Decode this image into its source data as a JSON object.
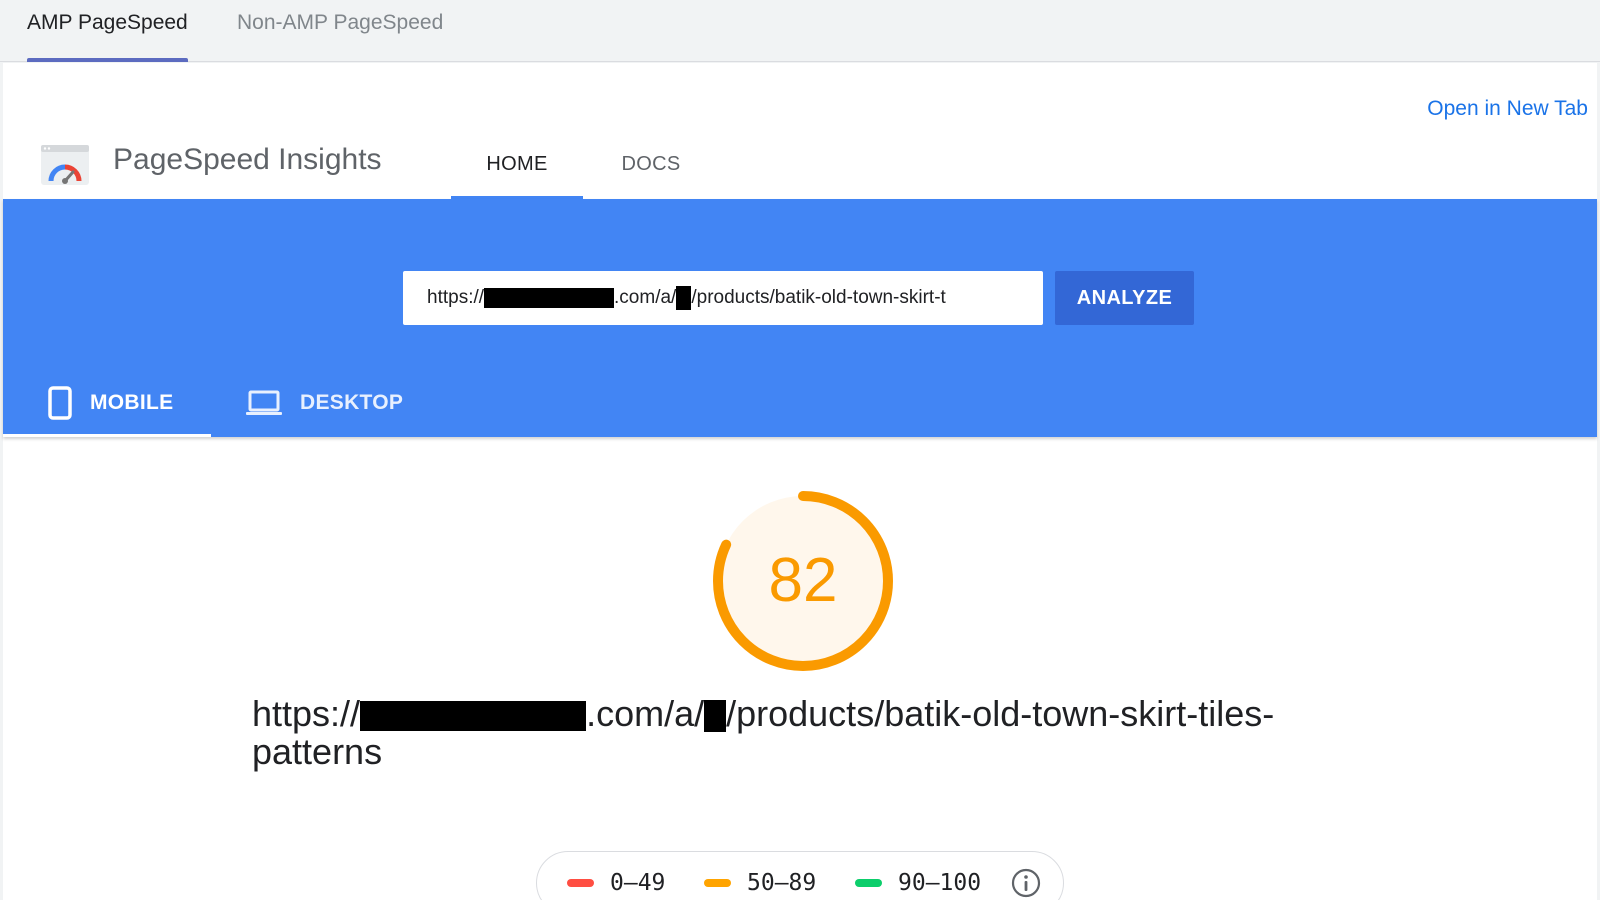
{
  "outer_tabs": [
    {
      "label": "AMP PageSpeed",
      "active": true
    },
    {
      "label": "Non-AMP PageSpeed",
      "active": false
    }
  ],
  "open_new_tab": "Open in New Tab",
  "app": {
    "title": "PageSpeed Insights",
    "nav": [
      {
        "label": "HOME",
        "active": true
      },
      {
        "label": "DOCS",
        "active": false
      }
    ]
  },
  "search": {
    "url_prefix": "https://",
    "url_middle": ".com/a/",
    "url_suffix": "/products/batik-old-town-skirt-t",
    "analyze_label": "ANALYZE"
  },
  "devices": [
    {
      "label": "MOBILE",
      "icon": "smartphone-icon",
      "active": true
    },
    {
      "label": "DESKTOP",
      "icon": "laptop-icon",
      "active": false
    }
  ],
  "result": {
    "score": "82",
    "score_value": 82,
    "url_prefix": "https://",
    "url_middle": ".com/a/",
    "url_suffix": "/products/batik-old-town-skirt-tiles-patterns"
  },
  "legend": [
    {
      "range": "0–49",
      "color": "#ff4e42"
    },
    {
      "range": "50–89",
      "color": "#ffa400"
    },
    {
      "range": "90–100",
      "color": "#0cce6b"
    }
  ],
  "colors": {
    "hero_blue": "#4285f4",
    "analyze_blue": "#3367d6",
    "score_orange": "#fa9a00",
    "score_fill": "#fff7ec"
  }
}
